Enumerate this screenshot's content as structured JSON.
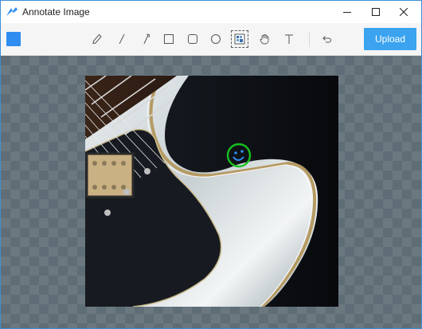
{
  "window": {
    "title": "Annotate Image",
    "controls": [
      "minimize",
      "maximize",
      "close"
    ]
  },
  "toolbar": {
    "selected_color": "#2f8cf0",
    "tools": [
      {
        "name": "pencil",
        "icon": "pencil-icon"
      },
      {
        "name": "line",
        "icon": "line-icon"
      },
      {
        "name": "arrow",
        "icon": "arrow-icon"
      },
      {
        "name": "rectangle",
        "icon": "rectangle-icon"
      },
      {
        "name": "rounded-rectangle",
        "icon": "rounded-rectangle-icon"
      },
      {
        "name": "ellipse",
        "icon": "ellipse-icon"
      },
      {
        "name": "blur",
        "icon": "blur-icon",
        "active": true
      },
      {
        "name": "pan",
        "icon": "hand-icon"
      },
      {
        "name": "text",
        "icon": "text-icon"
      },
      {
        "name": "undo",
        "icon": "undo-icon"
      }
    ],
    "upload_label": "Upload"
  },
  "image": {
    "description_subject": "electric guitar body",
    "annotation": {
      "shape": "circle",
      "color": "#18c020",
      "content": "smiley face",
      "face_color": "#2f8cf0"
    }
  },
  "colors": {
    "accent": "#3ba3ef",
    "canvas_checker_dark": "#5f6d76",
    "canvas_checker_light": "#6b7880"
  }
}
